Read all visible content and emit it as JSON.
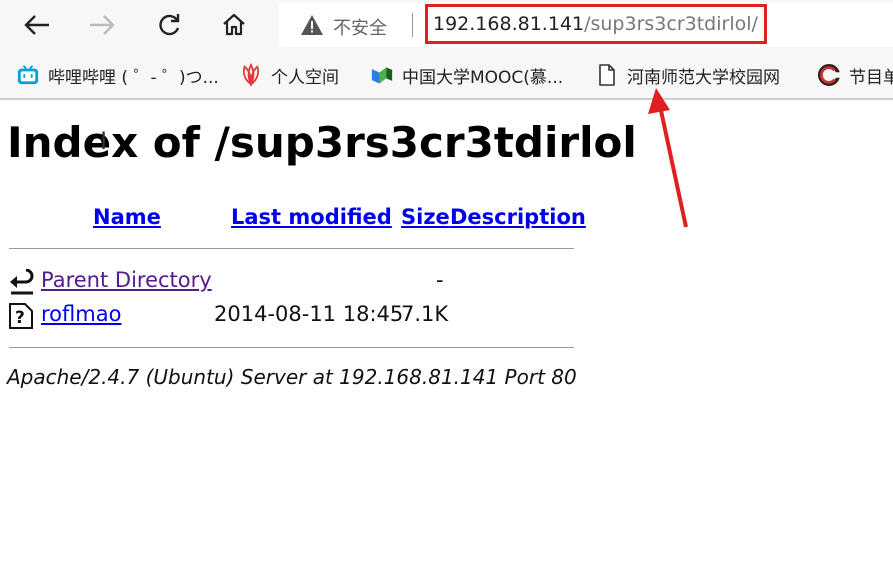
{
  "browser": {
    "security_label": "不安全",
    "url_host": "192.168.81.141",
    "url_path": "/sup3rs3cr3tdirlol/",
    "bookmarks": [
      {
        "label": "哔哩哔哩 ( ゜- ゜)つ...",
        "icon": "bilibili-icon"
      },
      {
        "label": "个人空间",
        "icon": "huawei-icon"
      },
      {
        "label": "中国大学MOOC(慕...",
        "icon": "mooc-icon"
      },
      {
        "label": "河南师范大学校园网",
        "icon": "page-icon"
      },
      {
        "label": "节目单",
        "icon": "c-logo-icon"
      }
    ]
  },
  "page": {
    "title": "Index of /sup3rs3cr3tdirlol",
    "columns": {
      "name": "Name",
      "last_modified": "Last modified",
      "size": "Size",
      "description": "Description"
    },
    "rows": [
      {
        "name": "Parent Directory",
        "last_modified": "",
        "size": "-",
        "description": ""
      },
      {
        "name": "roflmao",
        "last_modified": "2014-08-11 18:45",
        "size": "7.1K",
        "description": ""
      }
    ],
    "address": "Apache/2.4.7 (Ubuntu) Server at 192.168.81.141 Port 80"
  },
  "annotation": {
    "highlight_color": "#e02020"
  }
}
